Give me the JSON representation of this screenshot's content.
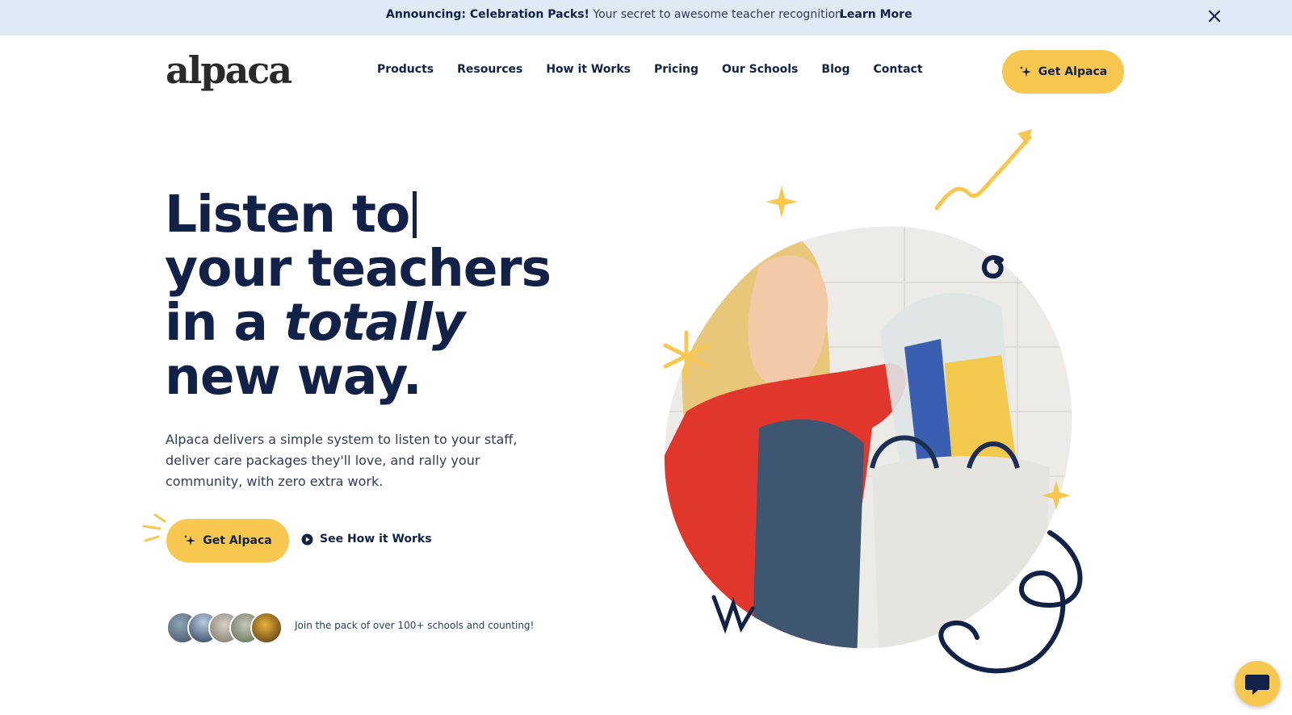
{
  "announcement": {
    "label": "Announcing: Celebration Packs!",
    "text": "Your secret to awesome teacher recognition",
    "link": "Learn More"
  },
  "brand": {
    "logo": "alpaca"
  },
  "nav": {
    "items": [
      "Products",
      "Resources",
      "How it Works",
      "Pricing",
      "Our Schools",
      "Blog",
      "Contact"
    ],
    "cta": "Get Alpaca"
  },
  "hero": {
    "title_line1": "Listen to",
    "title_line2": "your teachers",
    "title_line3_prefix": "in a ",
    "title_line3_emphasis": "totally",
    "title_line4": "new way.",
    "description": "Alpaca delivers a simple system to listen to your staff, deliver care packages they'll love, and rally your community, with zero extra work.",
    "primary_cta": "Get Alpaca",
    "secondary_cta": "See How it Works",
    "social_proof": "Join the pack of over 100+ schools and counting!"
  },
  "colors": {
    "navy": "#122147",
    "yellow": "#f7c750",
    "announcement_bg": "#dcebf4"
  },
  "icons": [
    "sparkle-icon",
    "close-icon",
    "play-icon",
    "chat-icon"
  ]
}
